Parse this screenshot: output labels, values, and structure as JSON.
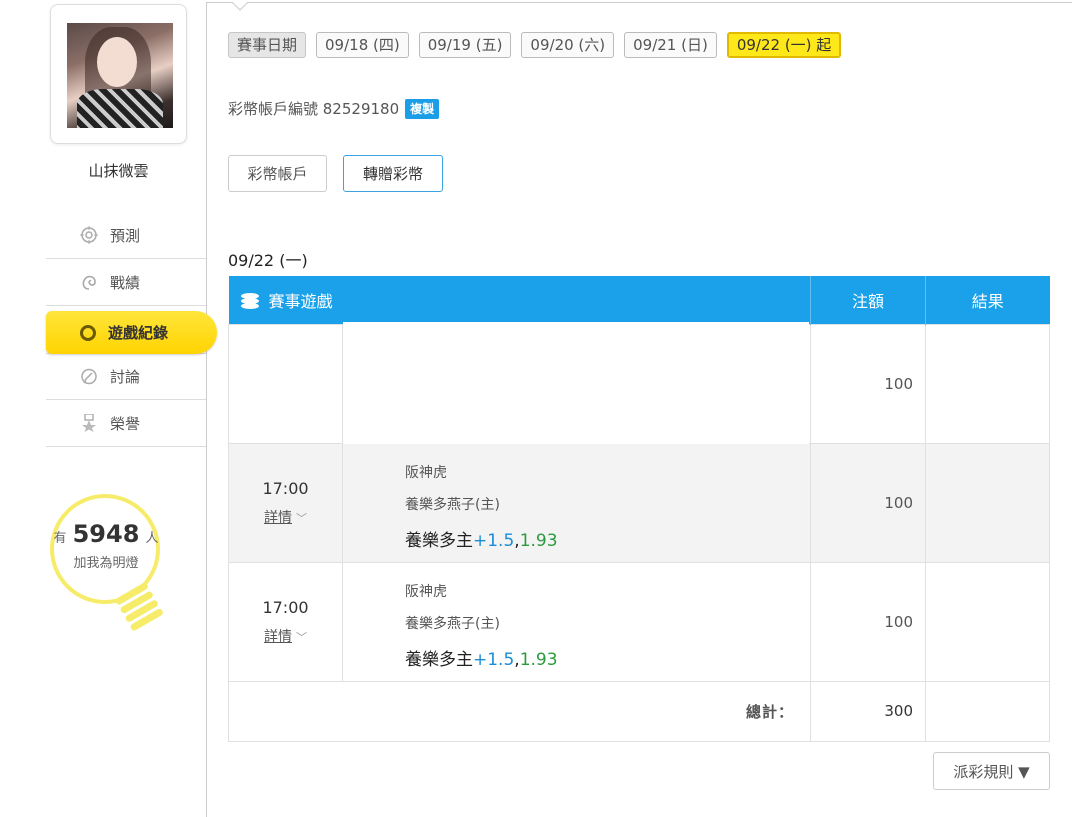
{
  "user": {
    "name": "山抹微雲"
  },
  "nav": {
    "items": [
      {
        "label": "預測",
        "icon": "target-icon"
      },
      {
        "label": "戰績",
        "icon": "swirl-icon"
      },
      {
        "label": "遊戲紀錄",
        "icon": "ring-icon",
        "active": true
      },
      {
        "label": "討論",
        "icon": "chat-icon"
      },
      {
        "label": "榮譽",
        "icon": "medal-icon"
      }
    ]
  },
  "fans": {
    "prefix": "有",
    "count": "5948",
    "suffix": "人",
    "text": "加我為明燈"
  },
  "dates": {
    "label": "賽事日期",
    "options": [
      "09/18 (四)",
      "09/19 (五)",
      "09/20 (六)",
      "09/21 (日)",
      "09/22 (一) 起"
    ],
    "selected": "09/22 (一) 起"
  },
  "account": {
    "label": "彩幣帳戶編號 82529180",
    "copy": "複製"
  },
  "buttons": {
    "account": "彩幣帳戶",
    "transfer": "轉贈彩幣"
  },
  "section_date": "09/22 (一)",
  "table": {
    "headers": {
      "game": "賽事遊戲",
      "amount": "注額",
      "result": "結果"
    },
    "rows": [
      {
        "time": "",
        "detail": "",
        "away": "",
        "home": "",
        "pick": "",
        "line": "",
        "odds": "",
        "amount": "100",
        "result": ""
      },
      {
        "time": "17:00",
        "detail": "詳情",
        "away": "阪神虎",
        "home": "養樂多燕子(主)",
        "pick": "養樂多主",
        "line": "+1.5",
        "odds": "1.93",
        "amount": "100",
        "result": ""
      },
      {
        "time": "17:00",
        "detail": "詳情",
        "away": "阪神虎",
        "home": "養樂多燕子(主)",
        "pick": "養樂多主",
        "line": "+1.5",
        "odds": "1.93",
        "amount": "100",
        "result": ""
      }
    ],
    "total_label": "總計：",
    "total_value": "300"
  },
  "rules_button": "派彩規則 ▼",
  "colors": {
    "accent": "#1aa1ea",
    "highlight": "#ffe81a",
    "line": "#1a8dd6",
    "odds": "#2a9b3c"
  }
}
